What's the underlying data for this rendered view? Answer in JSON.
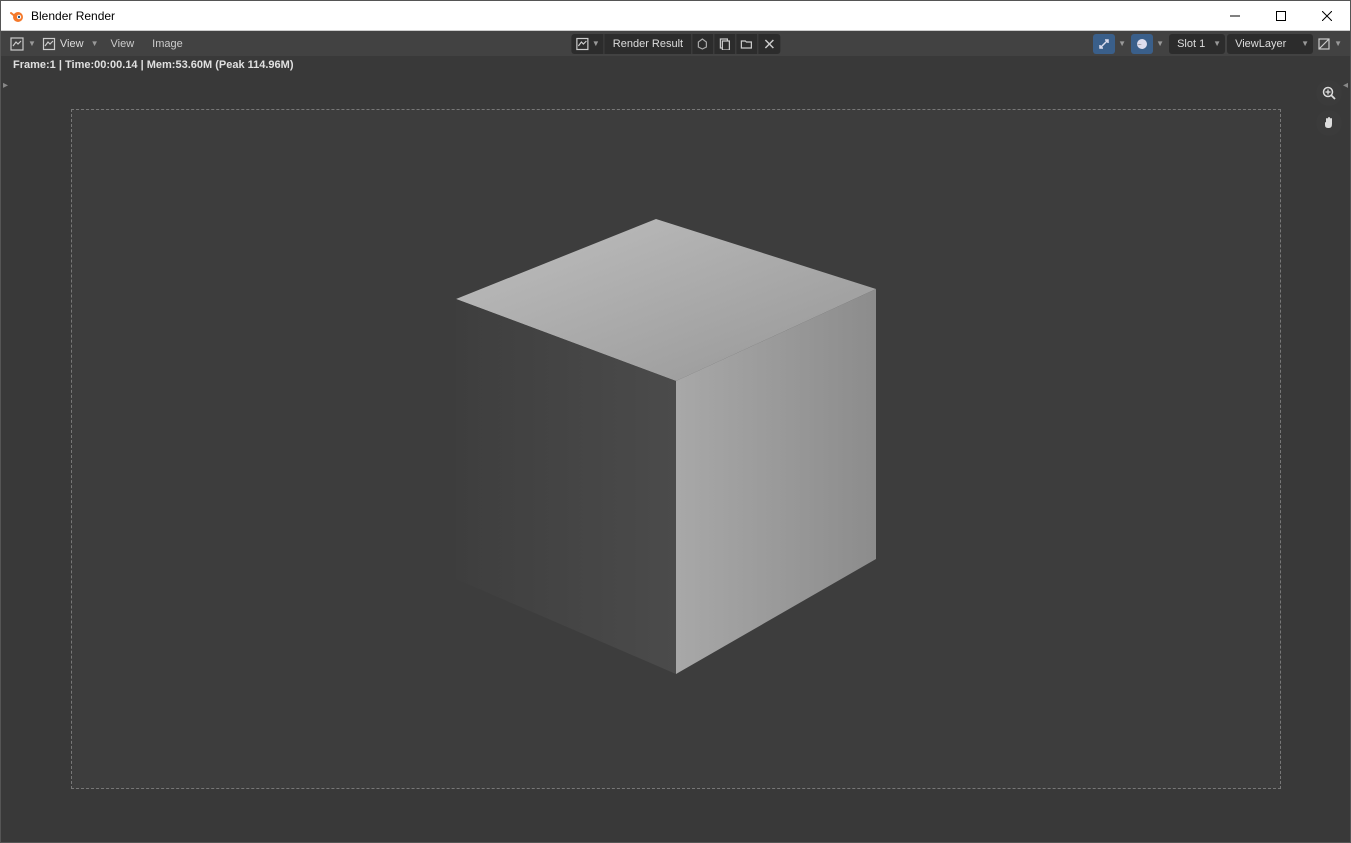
{
  "window": {
    "title": "Blender Render"
  },
  "toolbar": {
    "view_menu_label": "View",
    "view2_label": "View",
    "image_label": "Image",
    "render_result_label": "Render Result",
    "slot_label": "Slot 1",
    "layer_label": "ViewLayer"
  },
  "status": {
    "text": "Frame:1 | Time:00:00.14 | Mem:53.60M (Peak 114.96M)"
  }
}
